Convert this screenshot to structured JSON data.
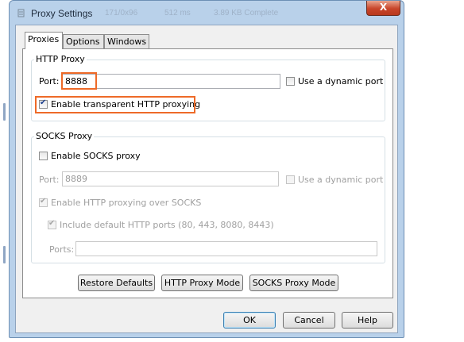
{
  "window": {
    "title": "Proxy Settings",
    "faded_title": [
      "171/0x96",
      "512 ms",
      "3.89 KB Complete"
    ],
    "close_label": "X"
  },
  "tabs": [
    {
      "label": "Proxies",
      "active": true
    },
    {
      "label": "Options",
      "active": false
    },
    {
      "label": "Windows",
      "active": false
    }
  ],
  "http_proxy": {
    "legend": "HTTP Proxy",
    "port_label": "Port:",
    "port_value": "8888",
    "dynamic_port_label": "Use a dynamic port",
    "dynamic_port_checked": false,
    "transparent_label": "Enable transparent HTTP proxying",
    "transparent_checked": true
  },
  "socks_proxy": {
    "legend": "SOCKS Proxy",
    "enable_label": "Enable SOCKS proxy",
    "enable_checked": false,
    "port_label": "Port:",
    "port_value": "8889",
    "dynamic_port_label": "Use a dynamic port",
    "http_over_socks_label": "Enable HTTP proxying over SOCKS",
    "http_over_socks_checked": true,
    "include_ports_label": "Include default HTTP ports (80, 443, 8080, 8443)",
    "include_ports_checked": true,
    "ports_label": "Ports:",
    "ports_value": ""
  },
  "panel_buttons": {
    "restore": "Restore Defaults",
    "http_mode": "HTTP Proxy Mode",
    "socks_mode": "SOCKS Proxy Mode"
  },
  "dialog_buttons": {
    "ok": "OK",
    "cancel": "Cancel",
    "help": "Help"
  },
  "colors": {
    "highlight": "#ee6a28",
    "window_frame": "#b9d1ea",
    "close_button": "#c8452a"
  }
}
